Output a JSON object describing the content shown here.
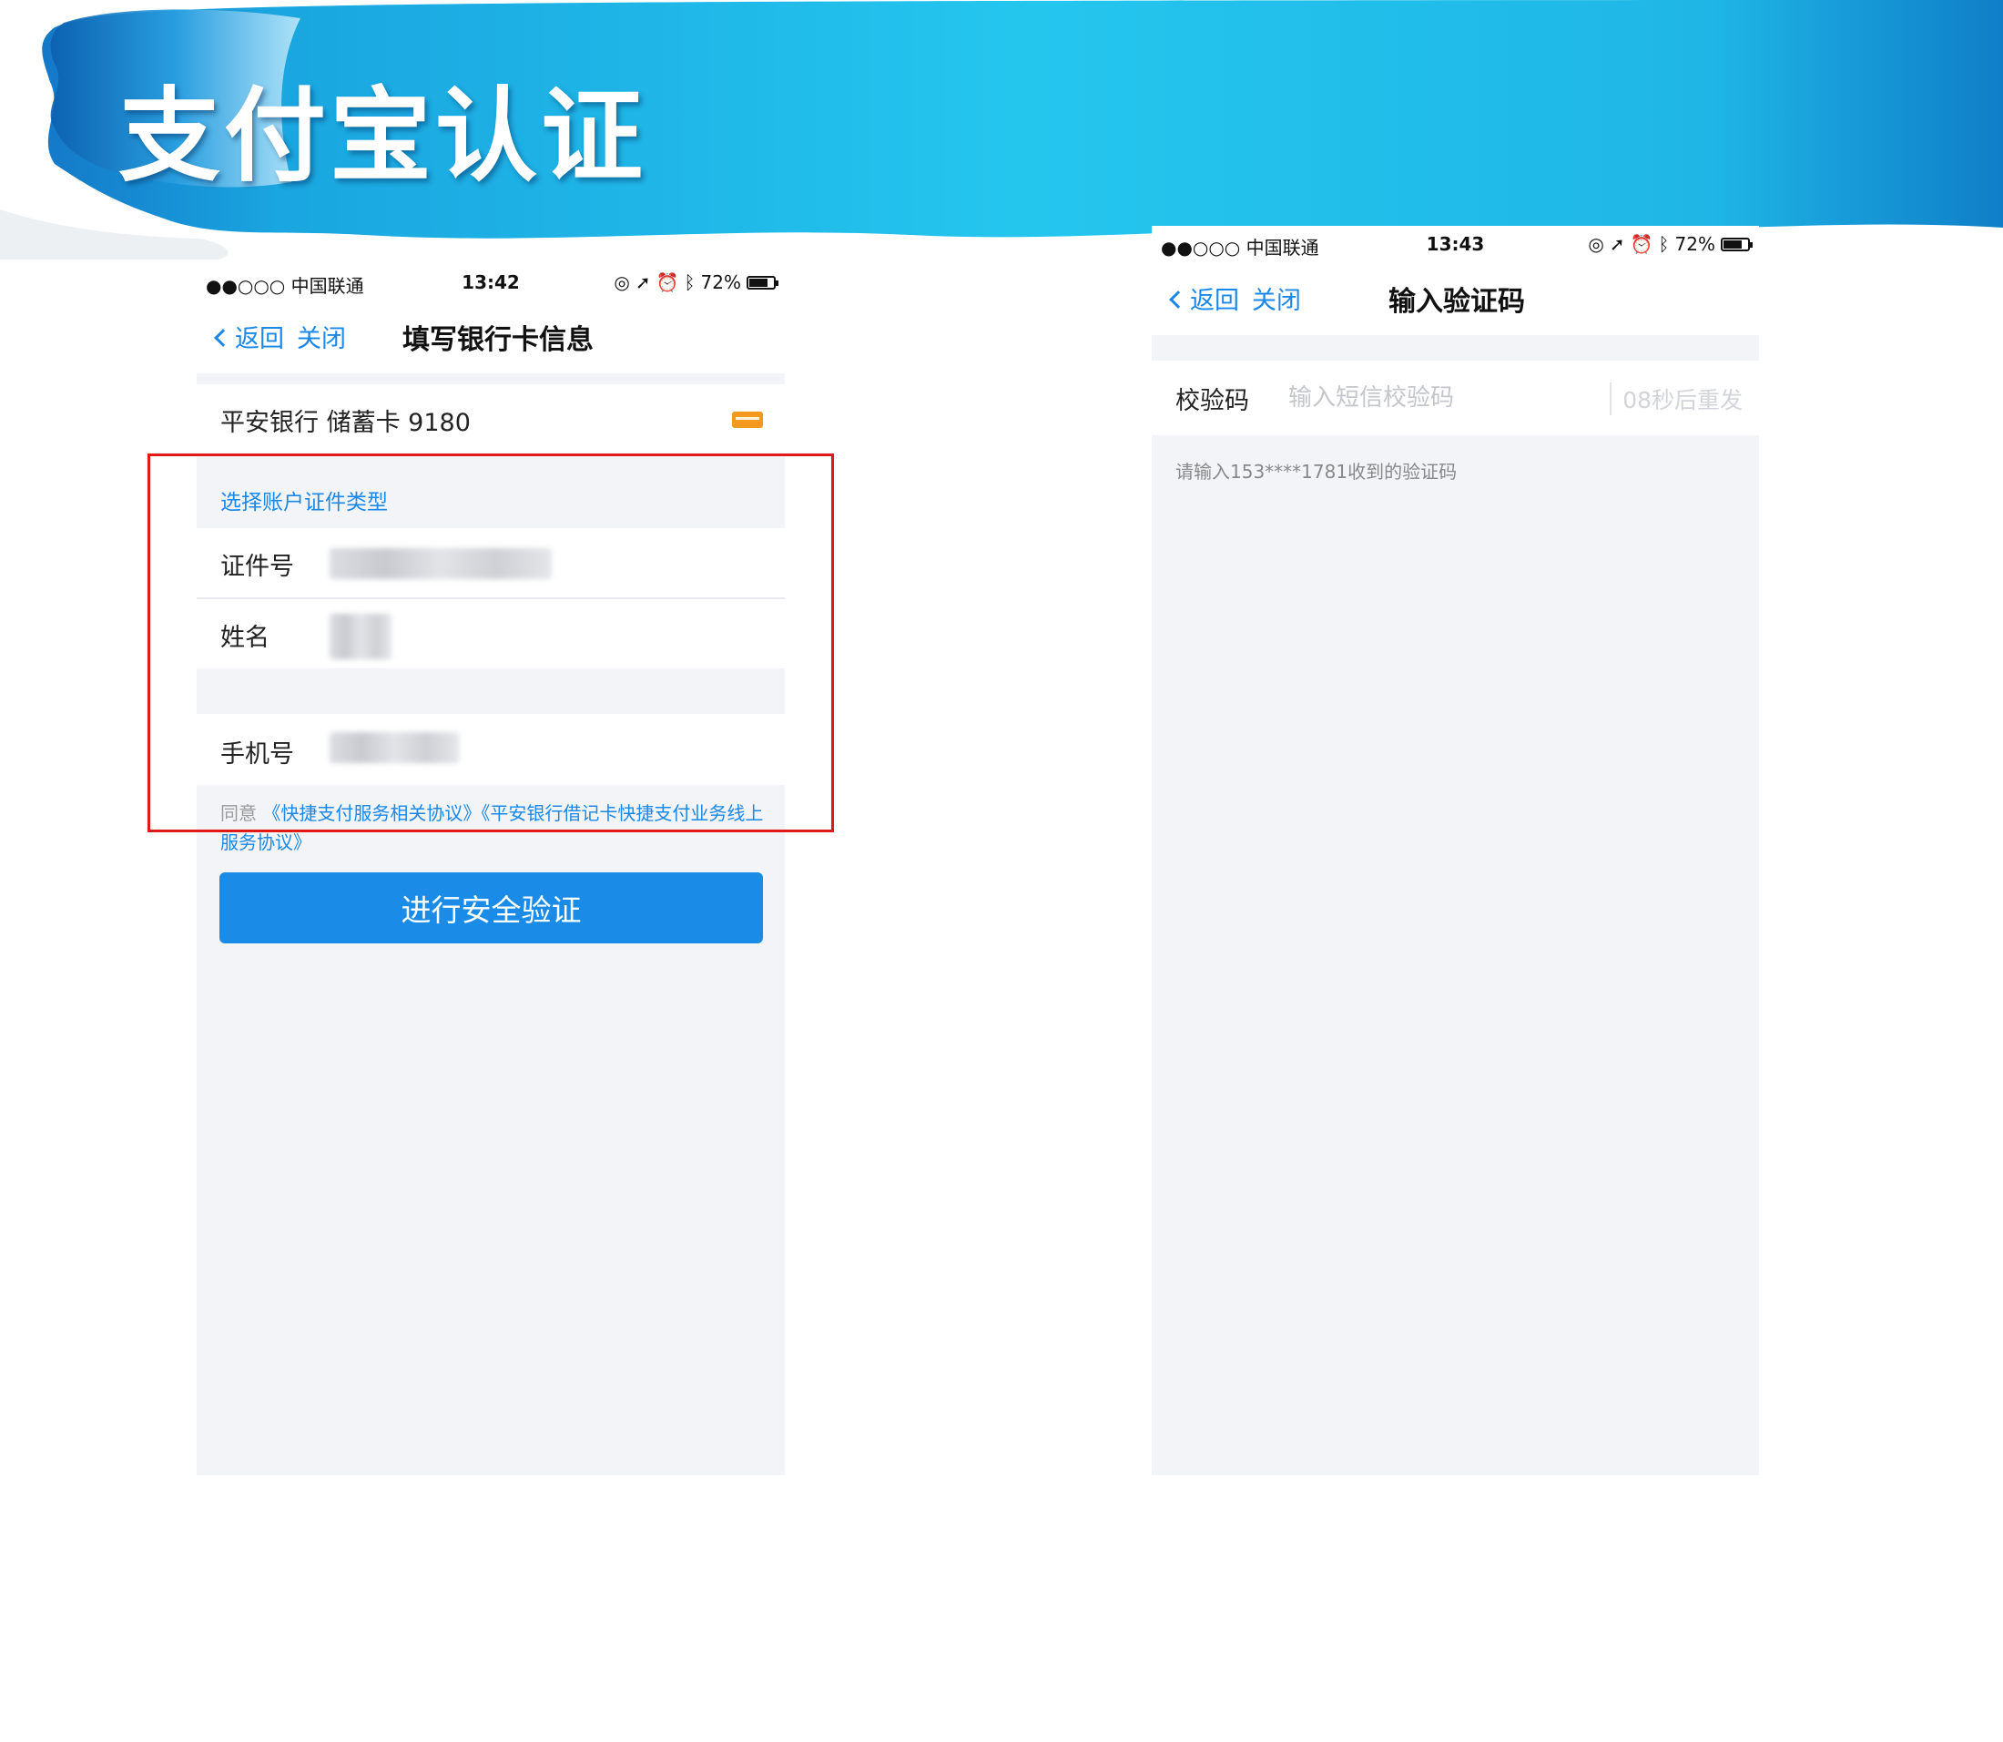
{
  "slide": {
    "title": "支付宝认证"
  },
  "phone_left": {
    "status": {
      "carrier": "●●○○○ 中国联通",
      "time": "13:42",
      "battery": "72%"
    },
    "nav": {
      "back": "返回",
      "close": "关闭",
      "title": "填写银行卡信息"
    },
    "bank_card": "平安银行  储蓄卡  9180",
    "section_label": "选择账户证件类型",
    "fields": {
      "id_label": "证件号",
      "name_label": "姓名",
      "phone_label": "手机号"
    },
    "agreement": {
      "prefix": "同意 ",
      "link1": "《快捷支付服务相关协议》",
      "link2": "《平安银行借记卡快捷支付业务线上服务协议》"
    },
    "submit": "进行安全验证"
  },
  "phone_right": {
    "status": {
      "carrier": "●●○○○ 中国联通",
      "time": "13:43",
      "battery": "72%"
    },
    "nav": {
      "back": "返回",
      "close": "关闭",
      "title": "输入验证码"
    },
    "code_label": "校验码",
    "code_placeholder": "输入短信校验码",
    "resend": "08秒后重发",
    "hint": "请输入153****1781收到的验证码"
  },
  "colors": {
    "accent": "#1a88e8",
    "button": "#1a8ce8",
    "highlight": "#e01a1a",
    "banner": "#22c4ec"
  }
}
